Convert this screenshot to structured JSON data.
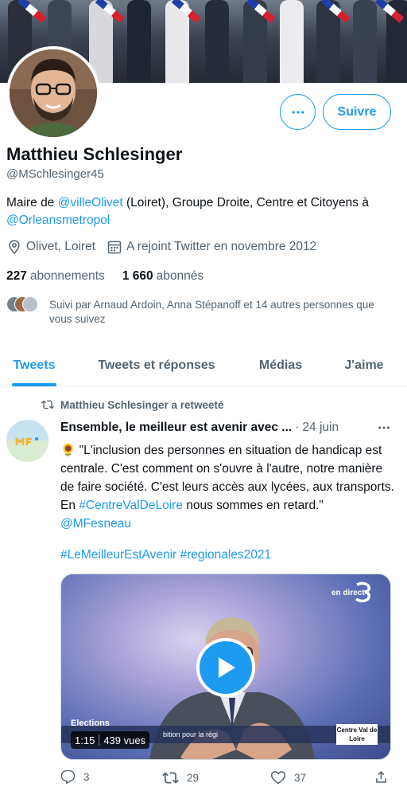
{
  "profile": {
    "name": "Matthieu Schlesinger",
    "handle": "@MSchlesinger45",
    "bio": {
      "prefix": "Maire de ",
      "mention1": "@villeOlivet",
      "middle": " (Loiret), Groupe Droite, Centre et Citoyens à ",
      "mention2": "@Orleansmetropol"
    },
    "location": "Olivet, Loiret",
    "joined": "A rejoint Twitter en novembre 2012",
    "following_count": "227",
    "following_label": "abonnements",
    "followers_count": "1 660",
    "followers_label": "abonnés",
    "followed_by": "Suivi par Arnaud Ardoin, Anna Stépanoff et 14 autres personnes que vous suivez",
    "follow_button": "Suivre",
    "more_button_icon": "more-icon"
  },
  "tabs": [
    {
      "label": "Tweets",
      "active": true
    },
    {
      "label": "Tweets et réponses",
      "active": false
    },
    {
      "label": "Médias",
      "active": false
    },
    {
      "label": "J'aime",
      "active": false
    }
  ],
  "tweet": {
    "retweet_label": "Matthieu Schlesinger a retweeté",
    "author": "Ensemble, le meilleur est avenir avec ...",
    "separator": "·",
    "date": "24 juin",
    "text_prefix": "🌻 \"L'inclusion des personnes en situation de handicap est centrale. C'est comment on s'ouvre à l'autre, notre manière de faire société. C'est leurs accès aux lycées, aux transports. En ",
    "text_tag": "#CentreValDeLoire",
    "text_middle": " nous sommes en retard.\" ",
    "text_mention": "@MFesneau",
    "hashtag1": "#LeMeilleurEstAvenir",
    "hashtag2": "#regionales2021",
    "media": {
      "duration": "1:15",
      "views": "439 vues",
      "live_label": "en direct",
      "chyron_title": "Elections",
      "chyron_text": "bition pour la régi",
      "channel_box": "Centre Val de Loire"
    },
    "replies": "3",
    "retweets": "29",
    "likes": "37"
  },
  "colors": {
    "accent": "#1d9bf0",
    "text": "#0f1419",
    "muted": "#536471"
  }
}
